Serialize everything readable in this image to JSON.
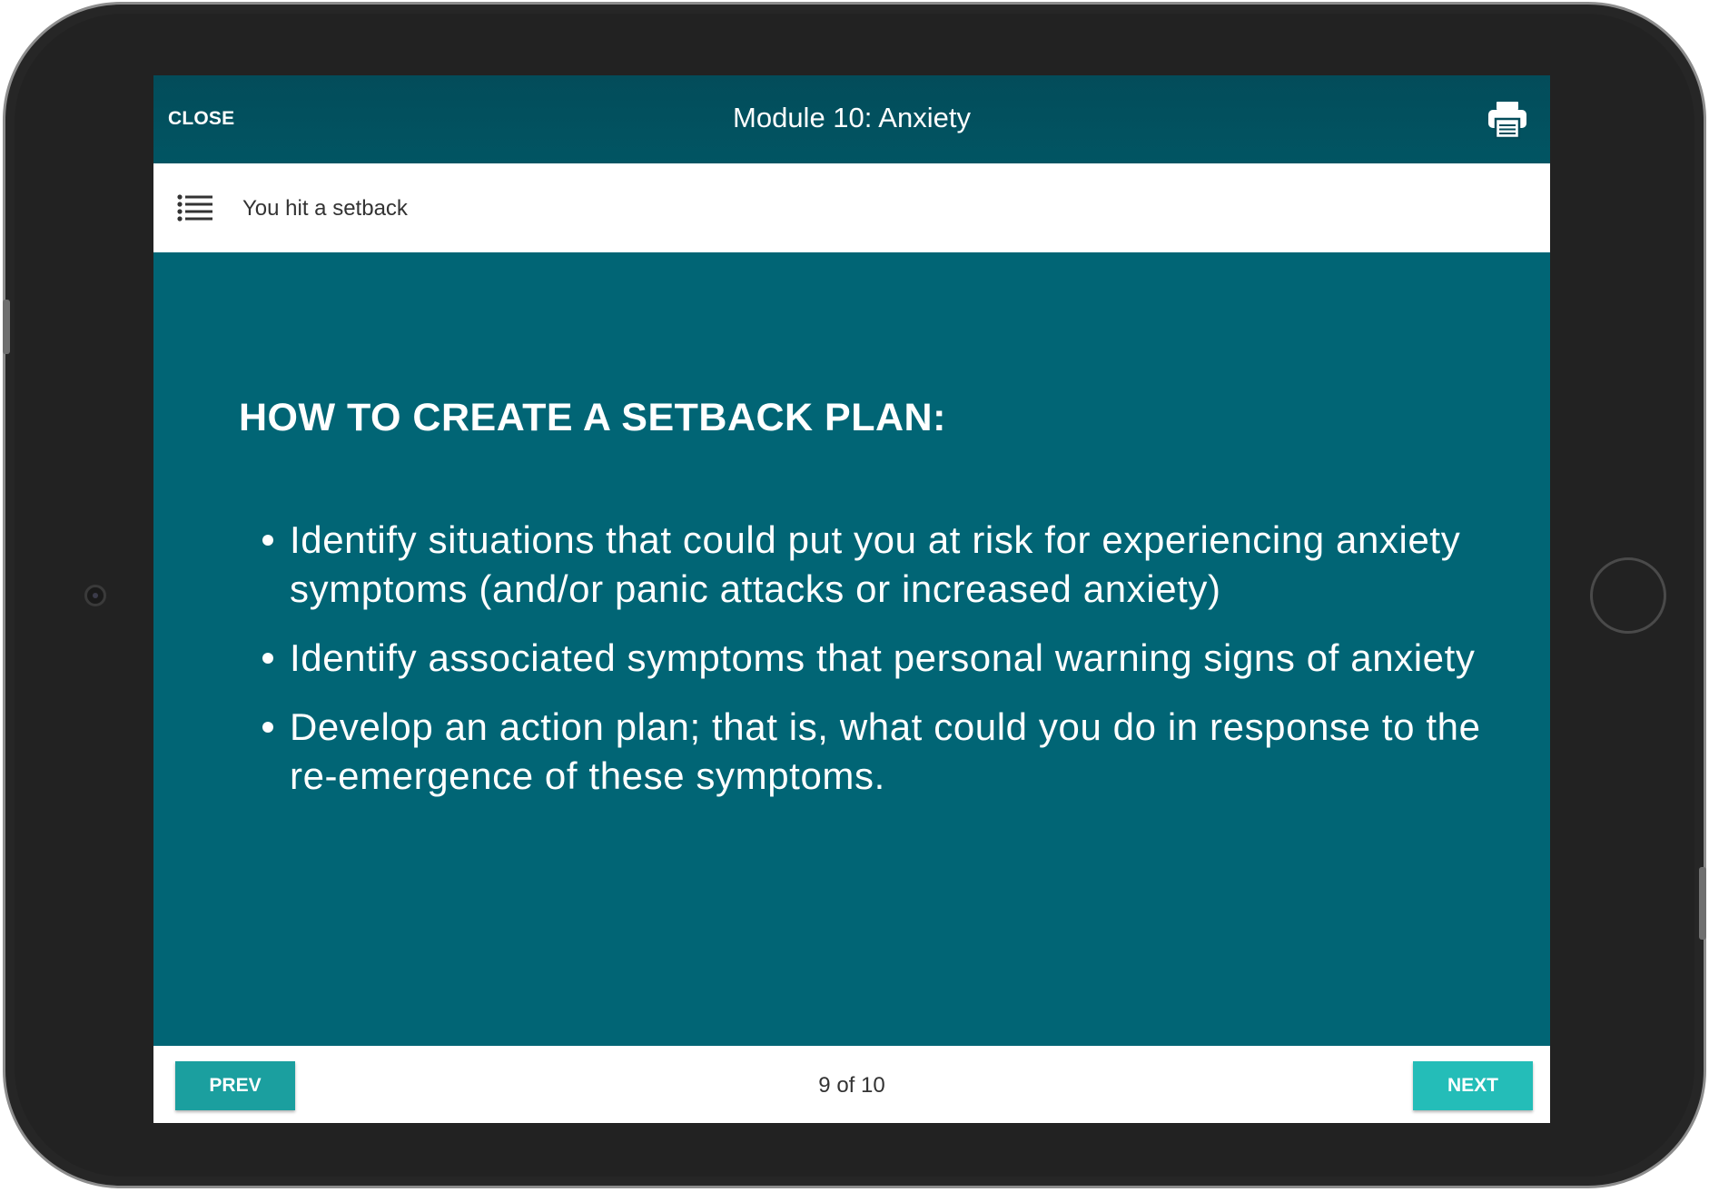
{
  "topbar": {
    "close_label": "CLOSE",
    "title": "Module 10: Anxiety",
    "print_icon": "printer-icon"
  },
  "subheader": {
    "menu_icon": "list-menu-icon",
    "section_title": "You hit a setback"
  },
  "content": {
    "heading": "HOW TO CREATE A SETBACK PLAN:",
    "bullets": [
      "Identify situations that could put you at risk for experiencing anxiety symptoms (and/or panic attacks or increased anxiety)",
      "Identify associated symptoms that personal warning signs of anxiety",
      "Develop an action plan; that is, what could you do in response to the re-emergence of these symptoms."
    ]
  },
  "footer": {
    "prev_label": "PREV",
    "next_label": "NEXT",
    "page_indicator": "9 of 10"
  },
  "colors": {
    "topbar": "#015563",
    "content_bg": "#016575",
    "prev_button": "#1b9f9f",
    "next_button": "#24bdb8",
    "device_frame": "#262626"
  }
}
